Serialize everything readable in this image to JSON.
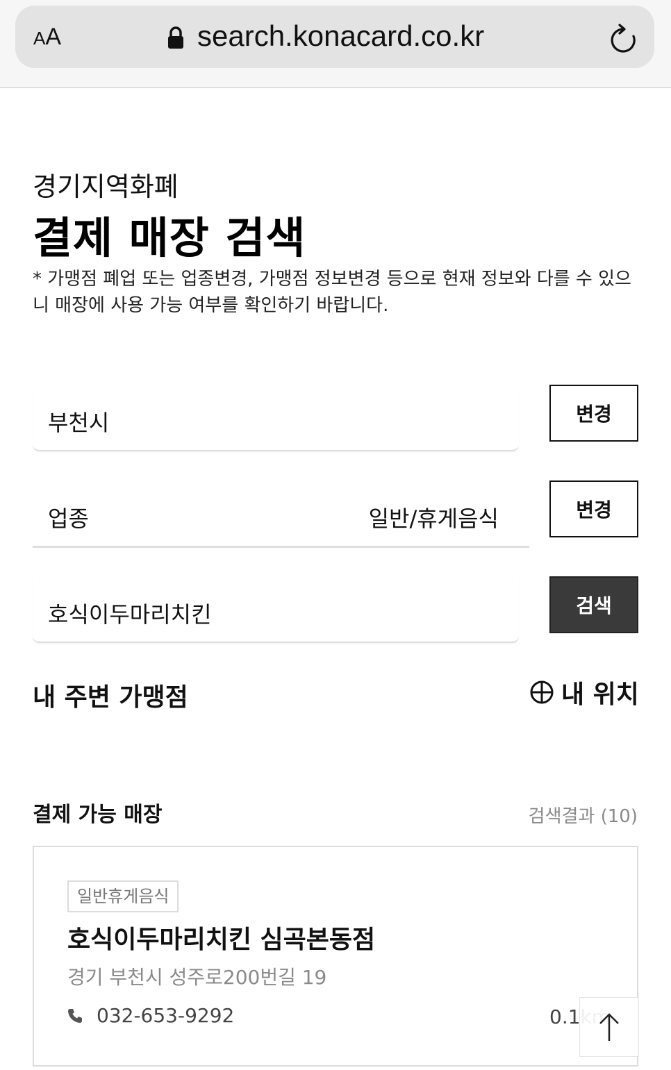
{
  "browser": {
    "text_size_label": "AA",
    "url": "search.konacard.co.kr"
  },
  "header": {
    "subtitle": "경기지역화폐",
    "title": "결제 매장 검색",
    "notice": "* 가맹점 폐업 또는 업종변경, 가맹점 정보변경 등으로 현재 정보와 다를 수 있으니 매장에 사용 가능 여부를 확인하기 바랍니다."
  },
  "form": {
    "region_value": "부천시",
    "region_button": "변경",
    "category_label": "업종",
    "category_value": "일반/휴게음식",
    "category_button": "변경",
    "search_value": "호식이두마리치킨",
    "search_button": "검색"
  },
  "nearby": {
    "title": "내 주변 가맹점",
    "my_location_label": "내 위치"
  },
  "results": {
    "title": "결제 가능 매장",
    "count_label": "검색결과 (10)",
    "items": [
      {
        "tag": "일반휴게음식",
        "name": "호식이두마리치킨 심곡본동점",
        "address": "경기 부천시 성주로200번길 19",
        "phone": "032-653-9292",
        "distance": "0.1km"
      }
    ]
  },
  "icons": {
    "lock": "lock-icon",
    "reload": "reload-icon",
    "crosshair": "crosshair-icon",
    "phone": "phone-icon",
    "arrow_up": "arrow-up-icon"
  }
}
